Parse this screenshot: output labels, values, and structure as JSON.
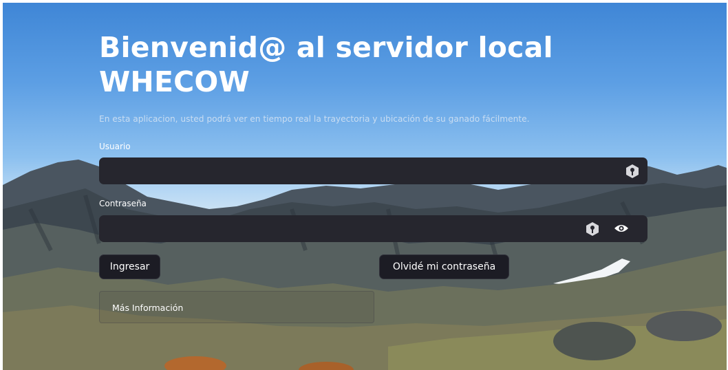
{
  "page": {
    "title": "Bienvenid@ al servidor local WHECOW",
    "subtitle": "En esta aplicacion, usted podrá ver en tiempo real la trayectoria y ubicación de su ganado fácilmente."
  },
  "form": {
    "username_label": "Usuario",
    "username_value": "",
    "password_label": "Contraseña",
    "password_value": "",
    "login_button": "Ingresar",
    "forgot_button": "Olvidé mi contraseña",
    "more_info": "Más Información"
  },
  "icons": {
    "username_field_icon": "key-icon",
    "password_field_icon": "key-icon",
    "password_toggle_icon": "eye-icon"
  },
  "colors": {
    "input_background": "#26262e",
    "button_background": "#1c1c24",
    "title_color": "#ffffff"
  }
}
